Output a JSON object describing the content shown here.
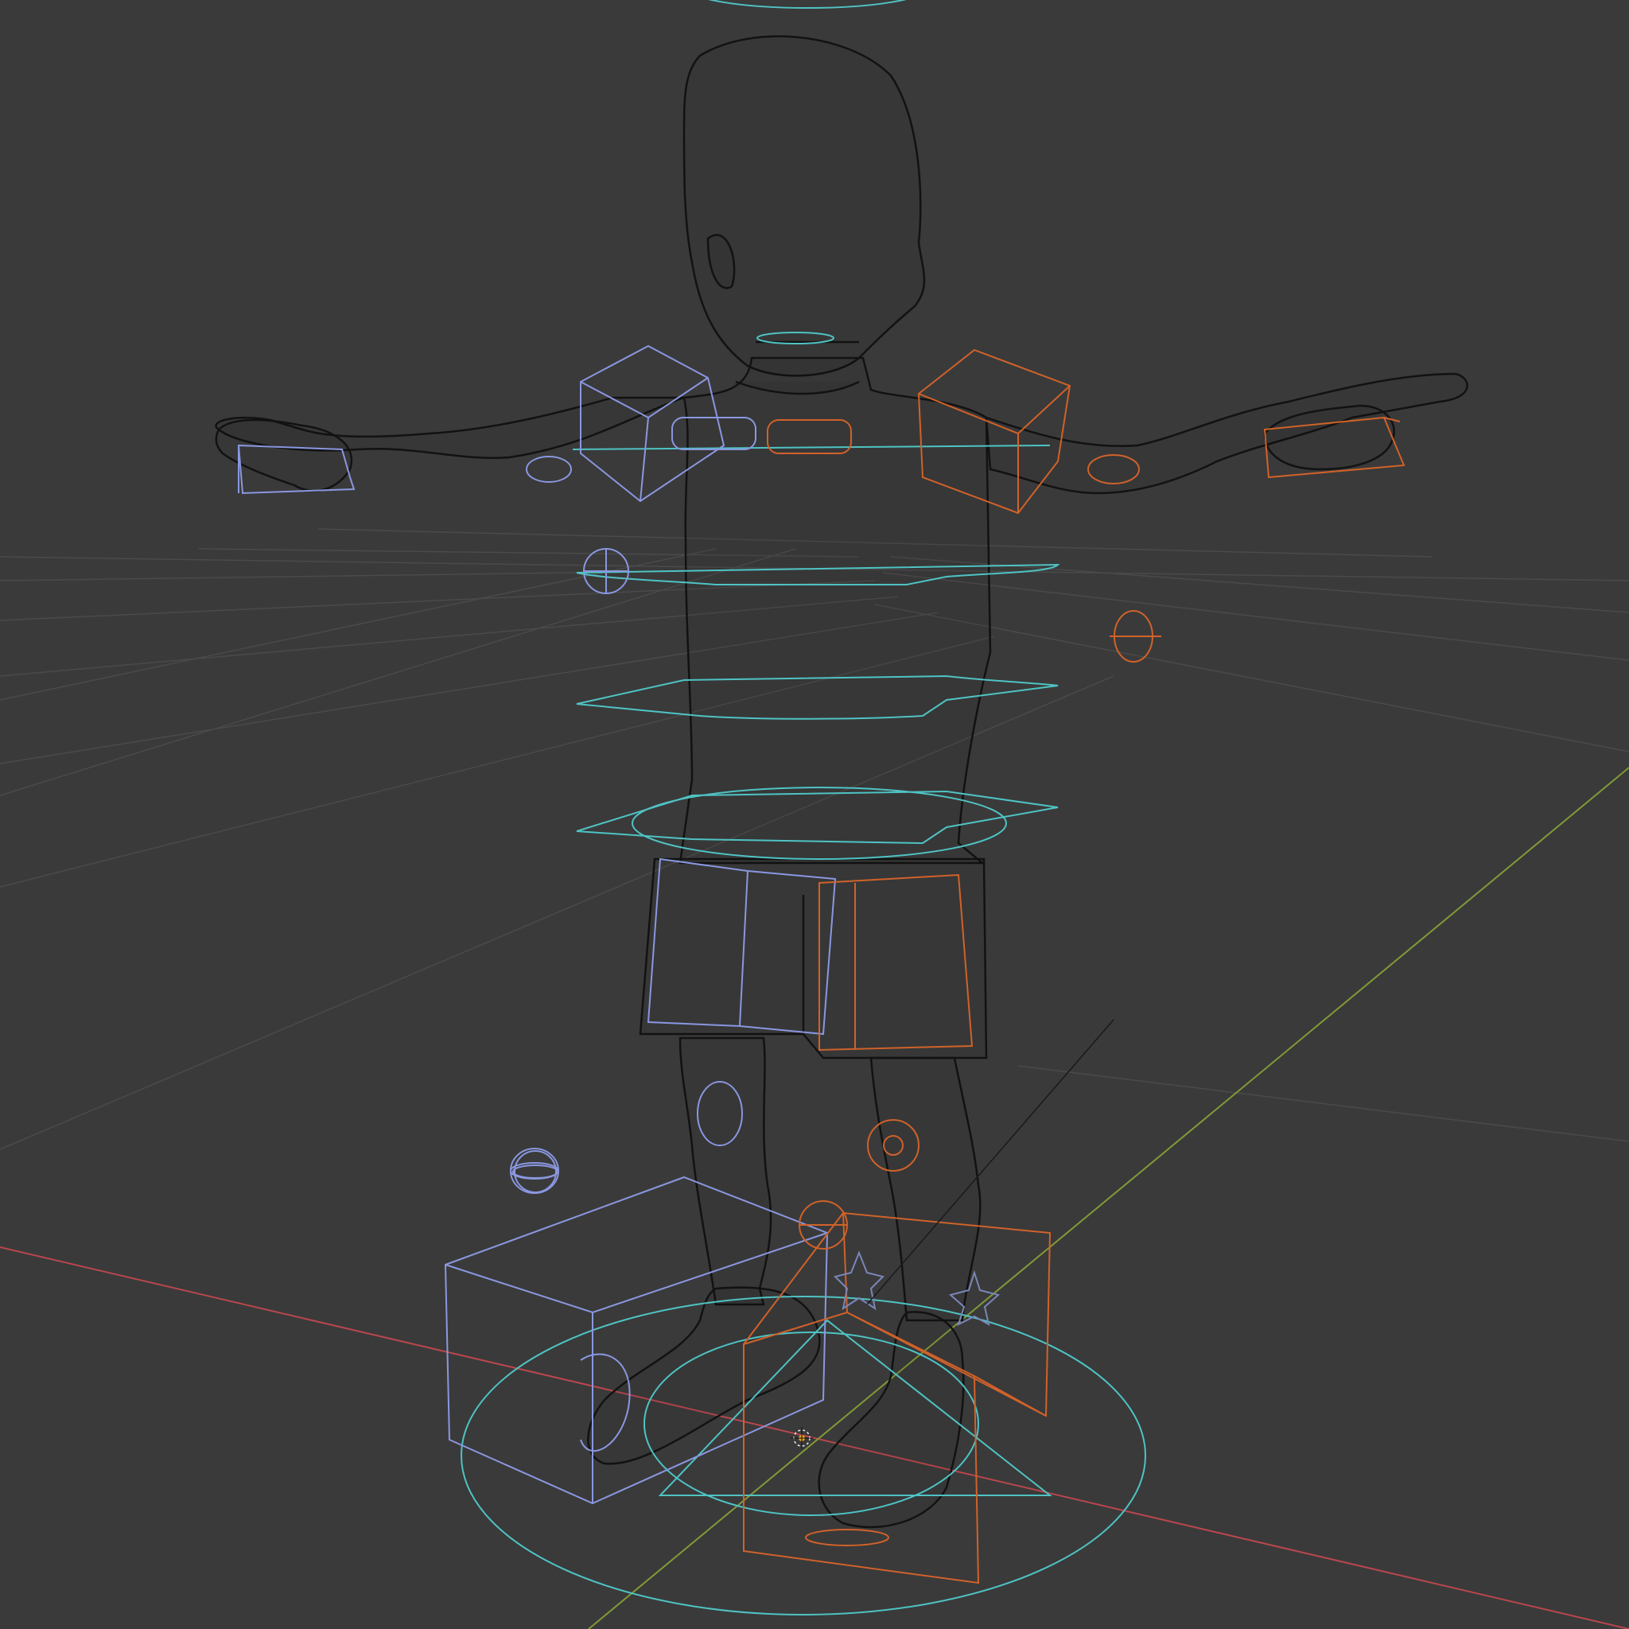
{
  "viewport": {
    "shading_mode": "wireframe",
    "background_color": "#3a3a3a",
    "grid_color": "#4a4a4a",
    "axis_x_color": "#b9474d",
    "axis_y_color": "#809a37"
  },
  "scene": {
    "mesh_wire_color": "#121212",
    "rig_center_color": "#4fc3c4",
    "rig_left_color": "#8a97e0",
    "rig_right_color": "#d0622a"
  }
}
